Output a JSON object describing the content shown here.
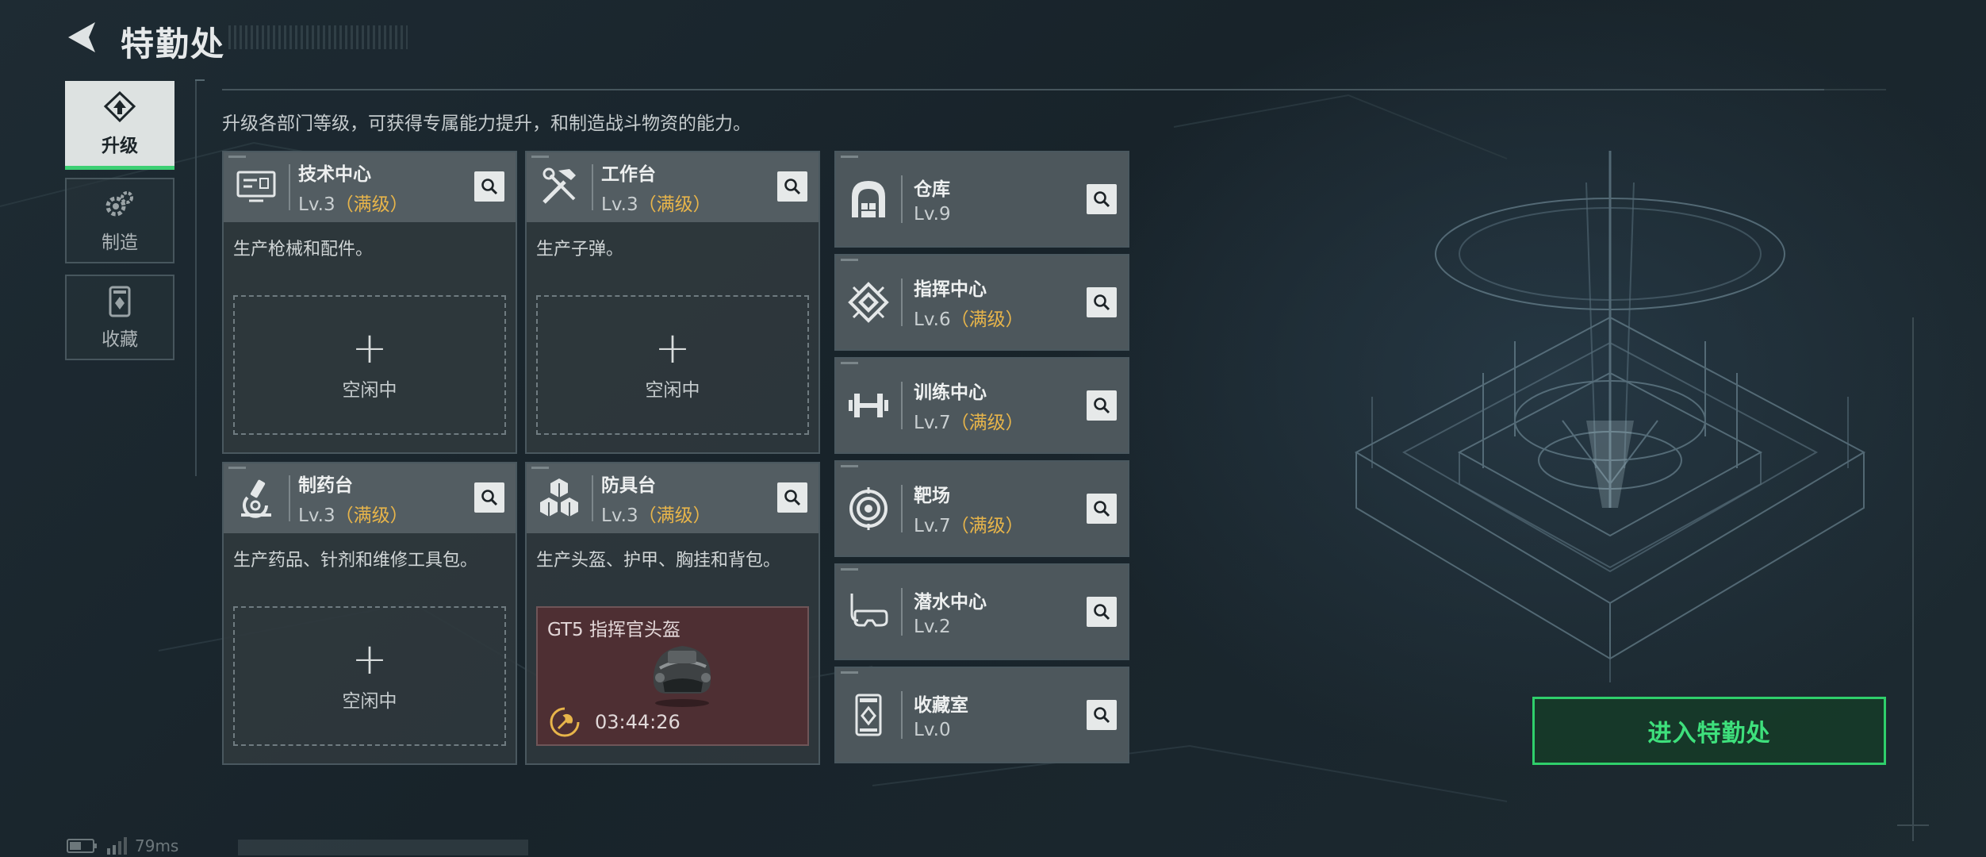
{
  "header": {
    "title": "特勤处"
  },
  "nav": [
    {
      "label": "升级",
      "icon": "upgrade-icon",
      "active": true
    },
    {
      "label": "制造",
      "icon": "gear-icon",
      "active": false
    },
    {
      "label": "收藏",
      "icon": "collection-icon",
      "active": false
    }
  ],
  "description": "升级各部门等级，可获得专属能力提升，和制造战斗物资的能力。",
  "cards": [
    {
      "name": "技术中心",
      "level": "Lv.3",
      "max": "（满级）",
      "desc": "生产枪械和配件。",
      "slot_plus": "+",
      "slot_status": "空闲中",
      "icon": "computer-icon"
    },
    {
      "name": "工作台",
      "level": "Lv.3",
      "max": "（满级）",
      "desc": "生产子弹。",
      "slot_plus": "+",
      "slot_status": "空闲中",
      "icon": "tools-icon"
    },
    {
      "name": "制药台",
      "level": "Lv.3",
      "max": "（满级）",
      "desc": "生产药品、针剂和维修工具包。",
      "slot_plus": "+",
      "slot_status": "空闲中",
      "icon": "microscope-icon"
    },
    {
      "name": "防具台",
      "level": "Lv.3",
      "max": "（满级）",
      "desc": "生产头盔、护甲、胸挂和背包。",
      "production": {
        "item": "GT5 指挥官头盔",
        "timer": "03:44:26"
      },
      "icon": "armor-boxes-icon"
    }
  ],
  "small_cards": [
    {
      "name": "仓库",
      "level": "Lv.9",
      "max": "",
      "icon": "warehouse-icon"
    },
    {
      "name": "指挥中心",
      "level": "Lv.6",
      "max": "（满级）",
      "icon": "command-chip-icon"
    },
    {
      "name": "训练中心",
      "level": "Lv.7",
      "max": "（满级）",
      "icon": "dumbbell-icon"
    },
    {
      "name": "靶场",
      "level": "Lv.7",
      "max": "（满级）",
      "icon": "target-icon"
    },
    {
      "name": "潜水中心",
      "level": "Lv.2",
      "max": "",
      "icon": "diving-mask-icon"
    },
    {
      "name": "收藏室",
      "level": "Lv.0",
      "max": "",
      "icon": "collection-room-icon"
    }
  ],
  "enter_button": "进入特勤处",
  "status": {
    "ping": "79ms"
  },
  "colors": {
    "accent_green": "#3ccf73",
    "max_level_gold": "#e8b54a",
    "production_bg": "#4e2f33"
  }
}
